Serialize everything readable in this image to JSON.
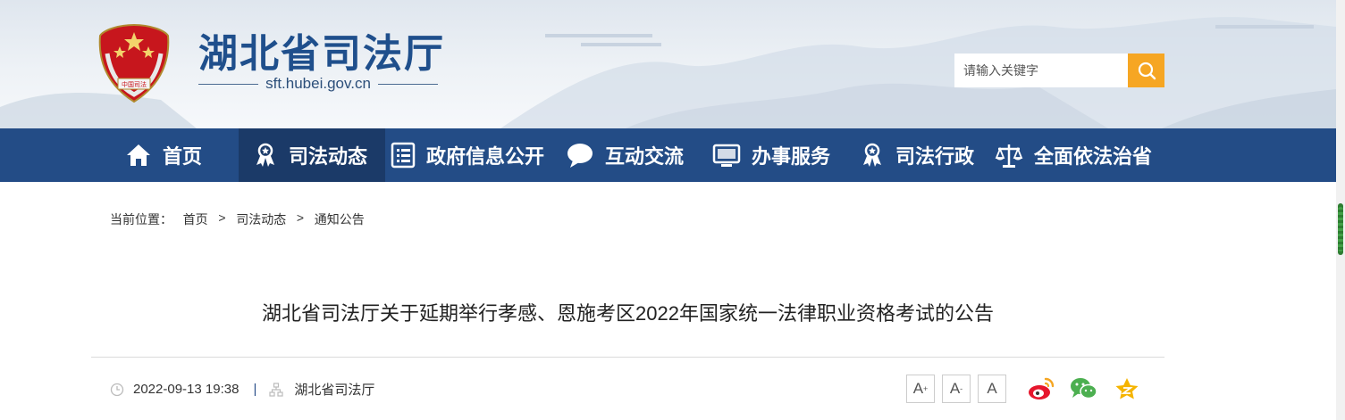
{
  "header": {
    "emblem_text": "中国司法",
    "site_title": "湖北省司法厅",
    "site_url": "sft.hubei.gov.cn",
    "search_placeholder": "请输入关键字",
    "search_icon": "search-icon"
  },
  "nav": {
    "items": [
      {
        "label": "首页",
        "icon": "home-icon"
      },
      {
        "label": "司法动态",
        "icon": "badge-icon",
        "active": true
      },
      {
        "label": "政府信息公开",
        "icon": "document-list-icon"
      },
      {
        "label": "互动交流",
        "icon": "chat-bubble-icon"
      },
      {
        "label": "办事服务",
        "icon": "monitor-icon"
      },
      {
        "label": "司法行政",
        "icon": "badge-icon"
      },
      {
        "label": "全面依法治省",
        "icon": "scales-icon"
      }
    ]
  },
  "breadcrumb": {
    "prefix": "当前位置：",
    "items": [
      "首页",
      "司法动态",
      "通知公告"
    ],
    "separator": ">"
  },
  "article": {
    "title": "湖北省司法厅关于延期举行孝感、恩施考区2022年国家统一法律职业资格考试的公告",
    "datetime": "2022-09-13 19:38",
    "meta_separator": "|",
    "source": "湖北省司法厅"
  },
  "tools": {
    "font_large": "A",
    "font_medium": "A",
    "font_small": "A",
    "share_icons": [
      "weibo-icon",
      "wechat-icon",
      "favorite-star-icon"
    ]
  },
  "colors": {
    "nav_bg": "#234c86",
    "nav_active_bg": "#1b3a68",
    "title_blue": "#1f4f8c",
    "search_btn": "#f6a623"
  }
}
